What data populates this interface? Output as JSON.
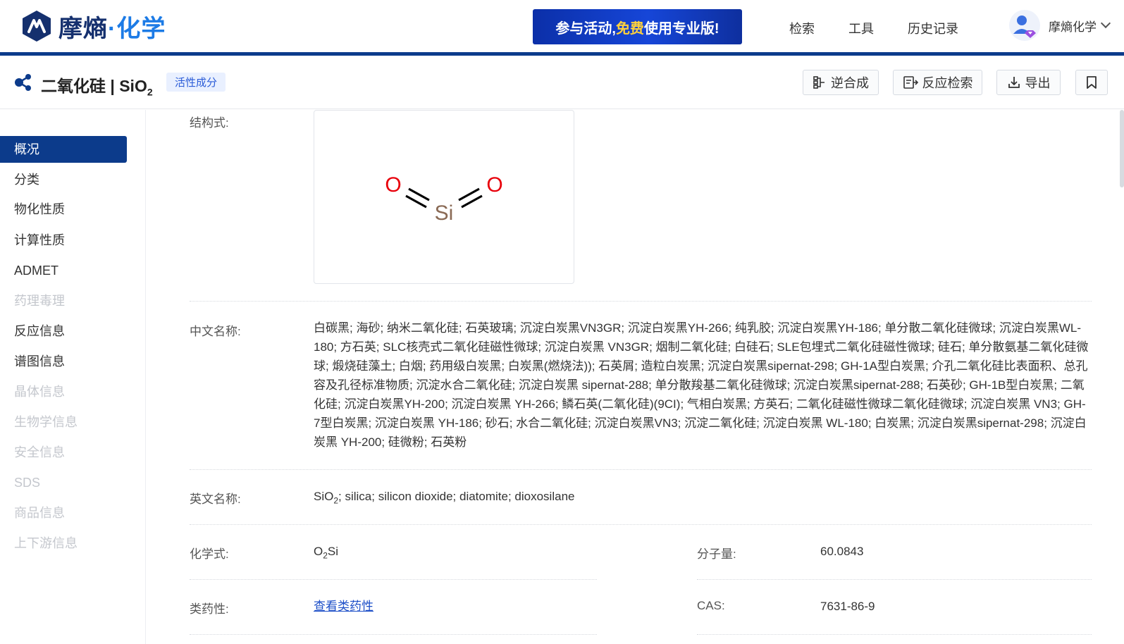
{
  "header": {
    "logo_main": "摩熵",
    "logo_dot": "·",
    "logo_accent": "化学",
    "promo": {
      "text_a": "参与活动,",
      "text_hl": "免费",
      "text_b": "使用专业版!"
    },
    "nav": [
      "检索",
      "工具",
      "历史记录"
    ],
    "user_name": "摩熵化学",
    "colors": {
      "brand": "#0c3b8b",
      "accent": "#1c7be6",
      "promo_highlight": "#ffd23c"
    }
  },
  "compound": {
    "title": "二氧化硅 | SiO",
    "title_sub": "2",
    "tag": "活性成分"
  },
  "toolbar": {
    "retro_label": "逆合成",
    "reaction_label": "反应检索",
    "export_label": "导出",
    "bookmark_icon": "bookmark-icon"
  },
  "sidebar": {
    "items": [
      {
        "label": "概况",
        "state": "active"
      },
      {
        "label": "分类",
        "state": "normal"
      },
      {
        "label": "物化性质",
        "state": "normal"
      },
      {
        "label": "计算性质",
        "state": "normal"
      },
      {
        "label": "ADMET",
        "state": "normal"
      },
      {
        "label": "药理毒理",
        "state": "disabled"
      },
      {
        "label": "反应信息",
        "state": "normal"
      },
      {
        "label": "谱图信息",
        "state": "normal"
      },
      {
        "label": "晶体信息",
        "state": "disabled"
      },
      {
        "label": "生物学信息",
        "state": "disabled"
      },
      {
        "label": "安全信息",
        "state": "disabled"
      },
      {
        "label": "SDS",
        "state": "disabled"
      },
      {
        "label": "商品信息",
        "state": "disabled"
      },
      {
        "label": "上下游信息",
        "state": "disabled"
      }
    ]
  },
  "overview": {
    "structure_label": "结构式:",
    "structure": {
      "atom_o": "O",
      "atom_si": "Si"
    },
    "cn_name_label": "中文名称:",
    "cn_names": "白碳黑; 海砂; 纳米二氧化硅; 石英玻璃; 沉淀白炭黑VN3GR; 沉淀白炭黑YH-266; 纯乳胶; 沉淀白炭黑YH-186; 单分散二氧化硅微球; 沉淀白炭黑WL-180; 方石英; SLC核壳式二氧化硅磁性微球; 沉淀白炭黑 VN3GR; 烟制二氧化硅; 白硅石; SLE包埋式二氧化硅磁性微球; 硅石; 单分散氨基二氧化硅微球; 煅烧硅藻土; 白烟; 药用级白炭黑; 白炭黑(燃烧法)); 石英屑; 造粒白炭黑; 沉淀白炭黑sipernat-298; GH-1A型白炭黑; 介孔二氧化硅比表面积、总孔容及孔径标准物质; 沉淀水合二氧化硅; 沉淀白炭黑 sipernat-288; 单分散羧基二氧化硅微球; 沉淀白炭黑sipernat-288; 石英砂; GH-1B型白炭黑; 二氧化硅; 沉淀白炭黑YH-200; 沉淀白炭黑 YH-266; 鳞石英(二氧化硅)(9CI); 气相白炭黑; 方英石; 二氧化硅磁性微球二氧化硅微球; 沉淀白炭黑 VN3; GH-7型白炭黑; 沉淀白炭黑 YH-186; 砂石; 水合二氧化硅; 沉淀白炭黑VN3; 沉淀二氧化硅; 沉淀白炭黑 WL-180; 白炭黑; 沉淀白炭黑sipernat-298; 沉淀白炭黑 YH-200; 硅微粉; 石英粉",
    "en_name_label": "英文名称:",
    "en_name_a": "SiO",
    "en_name_sub": "2",
    "en_name_b": "; silica; silicon dioxide; diatomite; dioxosilane",
    "formula_label": "化学式:",
    "formula_a": "O",
    "formula_sub": "2",
    "formula_b": "Si",
    "mw_label": "分子量:",
    "mw_value": "60.0843",
    "druglike_label": "类药性:",
    "druglike_link": "查看类药性",
    "cas_label": "CAS:",
    "cas_value": "7631-86-9"
  }
}
